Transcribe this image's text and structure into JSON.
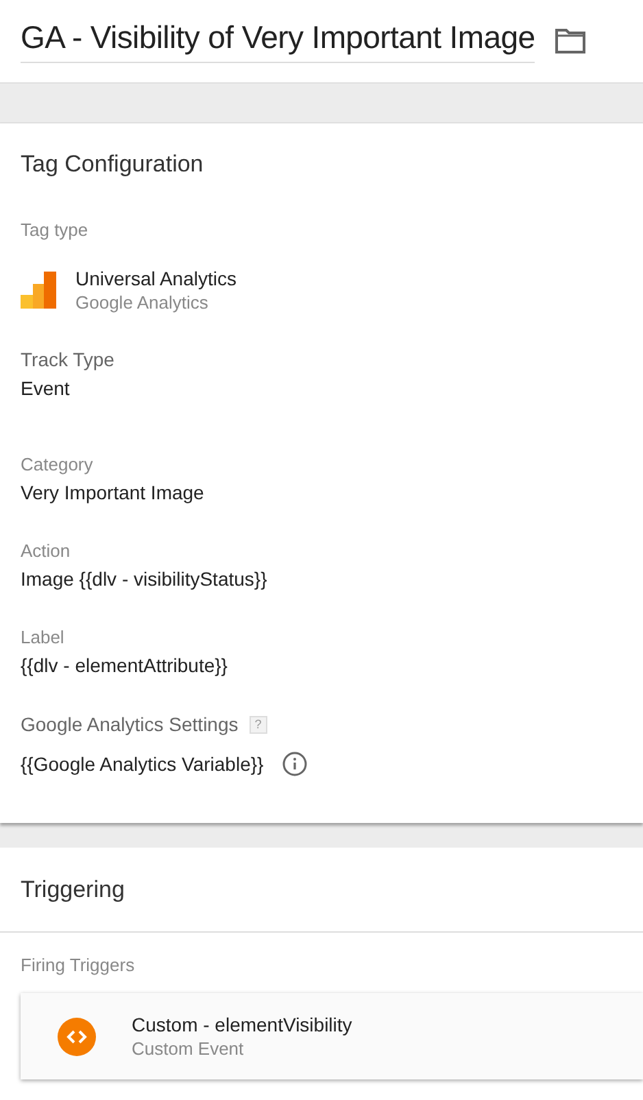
{
  "title": "GA - Visibility of Very Important Image",
  "tag_configuration": {
    "heading": "Tag Configuration",
    "tag_type_label": "Tag type",
    "tag_type": {
      "name": "Universal Analytics",
      "vendor": "Google Analytics"
    },
    "fields": [
      {
        "kind": "major",
        "label": "Track Type",
        "value": "Event"
      },
      {
        "kind": "minor",
        "label": "Category",
        "value": "Very Important Image"
      },
      {
        "kind": "minor",
        "label": "Action",
        "value": "Image {{dlv - visibilityStatus}}"
      },
      {
        "kind": "minor",
        "label": "Label",
        "value": "{{dlv - elementAttribute}}"
      }
    ],
    "settings": {
      "label": "Google Analytics Settings",
      "help": "?",
      "value": "{{Google Analytics Variable}}"
    }
  },
  "triggering": {
    "heading": "Triggering",
    "subheading": "Firing Triggers",
    "triggers": [
      {
        "name": "Custom - elementVisibility",
        "type": "Custom Event"
      }
    ]
  }
}
